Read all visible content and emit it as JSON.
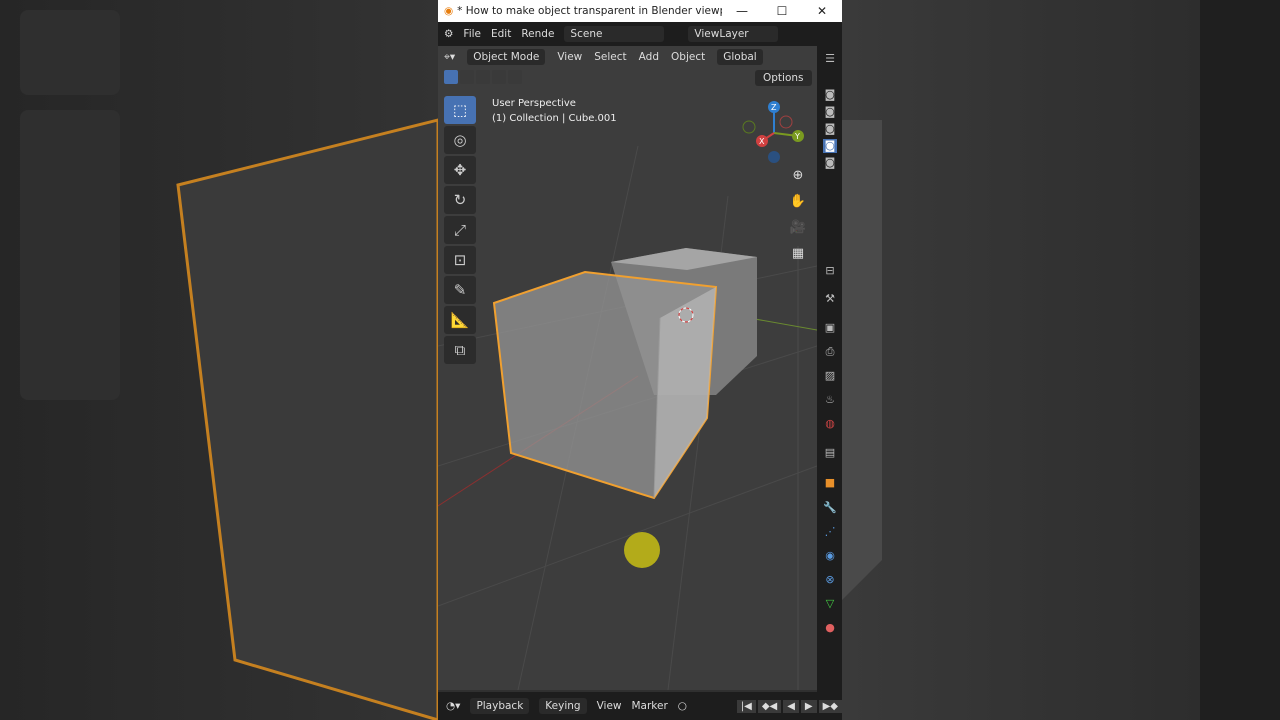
{
  "window": {
    "title": "* How to make object transparent in Blender viewport [...",
    "minimize": "—",
    "maximize": "☐",
    "close": "✕"
  },
  "topbar": {
    "menus": [
      "File",
      "Edit",
      "Rende"
    ],
    "scene": "Scene",
    "view_layer": "ViewLayer"
  },
  "viewport_header": {
    "mode": "Object Mode",
    "menus": [
      "View",
      "Select",
      "Add",
      "Object"
    ],
    "orientation": "Global",
    "options": "Options"
  },
  "overlay": {
    "perspective": "User Perspective",
    "collection": "(1) Collection | Cube.001"
  },
  "gizmo": {
    "x": "X",
    "y": "Y",
    "z": "Z"
  },
  "timeline": {
    "menus": [
      "Playback",
      "Keying",
      "View",
      "Marker"
    ]
  },
  "colors": {
    "selection": "#f0a030",
    "accent": "#4772b3",
    "cursor_highlight": "#c8be14"
  }
}
